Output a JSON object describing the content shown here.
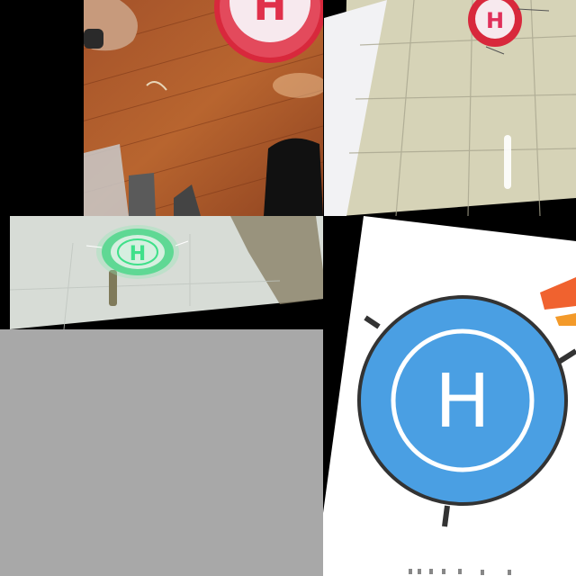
{
  "collage": {
    "tiles": [
      {
        "id": "wood-floor-pad",
        "pad_letter": "H",
        "pad_color": "#e0304a"
      },
      {
        "id": "tile-floor-pad",
        "pad_letter": "H",
        "pad_color": "#e0305a"
      },
      {
        "id": "glowing-pad",
        "pad_letter": "H",
        "pad_color": "#3fe08a"
      },
      {
        "id": "blue-helipad-drawing",
        "pad_letter": "H",
        "pad_color": "#4a9fe3"
      }
    ],
    "empty_area_color": "#a8a8a8"
  }
}
